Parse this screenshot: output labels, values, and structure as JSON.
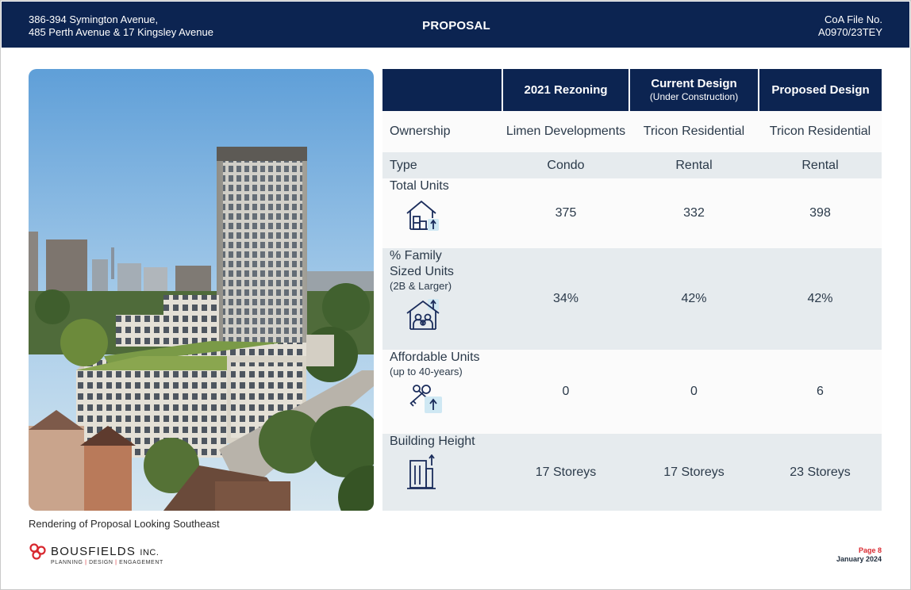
{
  "header": {
    "address_line1": "386-394 Symington Avenue,",
    "address_line2": "485 Perth Avenue & 17 Kingsley Avenue",
    "title": "PROPOSAL",
    "file_label": "CoA File No.",
    "file_number": "A0970/23TEY"
  },
  "image": {
    "caption": "Rendering of Proposal Looking Southeast"
  },
  "table": {
    "columns": [
      {
        "title": "",
        "subtitle": ""
      },
      {
        "title": "2021 Rezoning",
        "subtitle": ""
      },
      {
        "title": "Current Design",
        "subtitle": "(Under Construction)"
      },
      {
        "title": "Proposed Design",
        "subtitle": ""
      }
    ],
    "rows": [
      {
        "label": "Ownership",
        "label_sub": "",
        "icon": "",
        "values": [
          "Limen Developments",
          "Tricon Residential",
          "Tricon Residential"
        ]
      },
      {
        "label": "Type",
        "label_sub": "",
        "icon": "",
        "values": [
          "Condo",
          "Rental",
          "Rental"
        ]
      },
      {
        "label": "Total Units",
        "label_sub": "",
        "icon": "house-units-icon",
        "values": [
          "375",
          "332",
          "398"
        ]
      },
      {
        "label": "% Family Sized Units",
        "label_sub": "(2B & Larger)",
        "icon": "family-house-icon",
        "values": [
          "34%",
          "42%",
          "42%"
        ]
      },
      {
        "label": "Affordable Units",
        "label_sub": "(up to 40-years)",
        "icon": "key-icon",
        "values": [
          "0",
          "0",
          "6"
        ]
      },
      {
        "label": "Building Height",
        "label_sub": "",
        "icon": "building-height-icon",
        "values": [
          "17 Storeys",
          "17 Storeys",
          "23 Storeys"
        ]
      }
    ]
  },
  "footer": {
    "logo_name": "BOUSFIELDS",
    "logo_suffix": "INC.",
    "logo_tag1": "PLANNING",
    "logo_tag2": "DESIGN",
    "logo_tag3": "ENGAGEMENT",
    "page": "Page 8",
    "date": "January 2024"
  },
  "colors": {
    "navy": "#0c2451",
    "row_grey": "#e6ebee",
    "accent_red": "#d8282f",
    "icon_blue": "#1b2d5c",
    "icon_fill": "#cfe8f3"
  }
}
